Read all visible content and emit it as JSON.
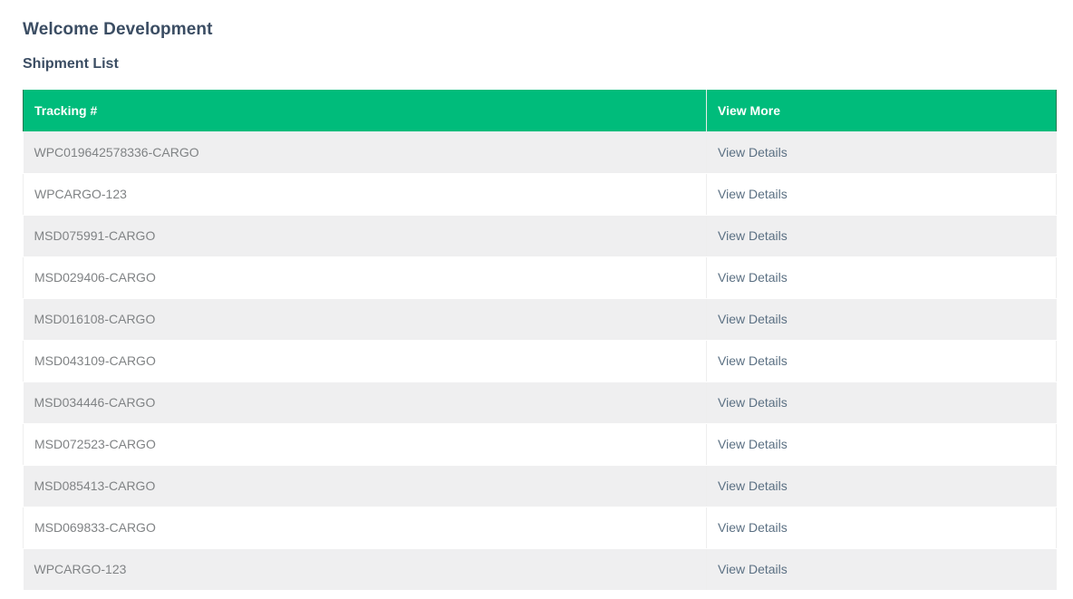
{
  "header": {
    "welcome": "Welcome Development",
    "section_title": "Shipment List"
  },
  "table": {
    "columns": [
      "Tracking #",
      "View More"
    ],
    "rows": [
      {
        "tracking": "WPC019642578336-CARGO",
        "link": "View Details"
      },
      {
        "tracking": "WPCARGO-123",
        "link": "View Details"
      },
      {
        "tracking": "MSD075991-CARGO",
        "link": "View Details"
      },
      {
        "tracking": "MSD029406-CARGO",
        "link": "View Details"
      },
      {
        "tracking": "MSD016108-CARGO",
        "link": "View Details"
      },
      {
        "tracking": "MSD043109-CARGO",
        "link": "View Details"
      },
      {
        "tracking": "MSD034446-CARGO",
        "link": "View Details"
      },
      {
        "tracking": "MSD072523-CARGO",
        "link": "View Details"
      },
      {
        "tracking": "MSD085413-CARGO",
        "link": "View Details"
      },
      {
        "tracking": "MSD069833-CARGO",
        "link": "View Details"
      },
      {
        "tracking": "WPCARGO-123",
        "link": "View Details"
      }
    ]
  },
  "colors": {
    "header_bg": "#00bc7b",
    "title_text": "#3b4d63",
    "row_alt_bg": "#efeff0",
    "link_text": "#5b7083"
  }
}
